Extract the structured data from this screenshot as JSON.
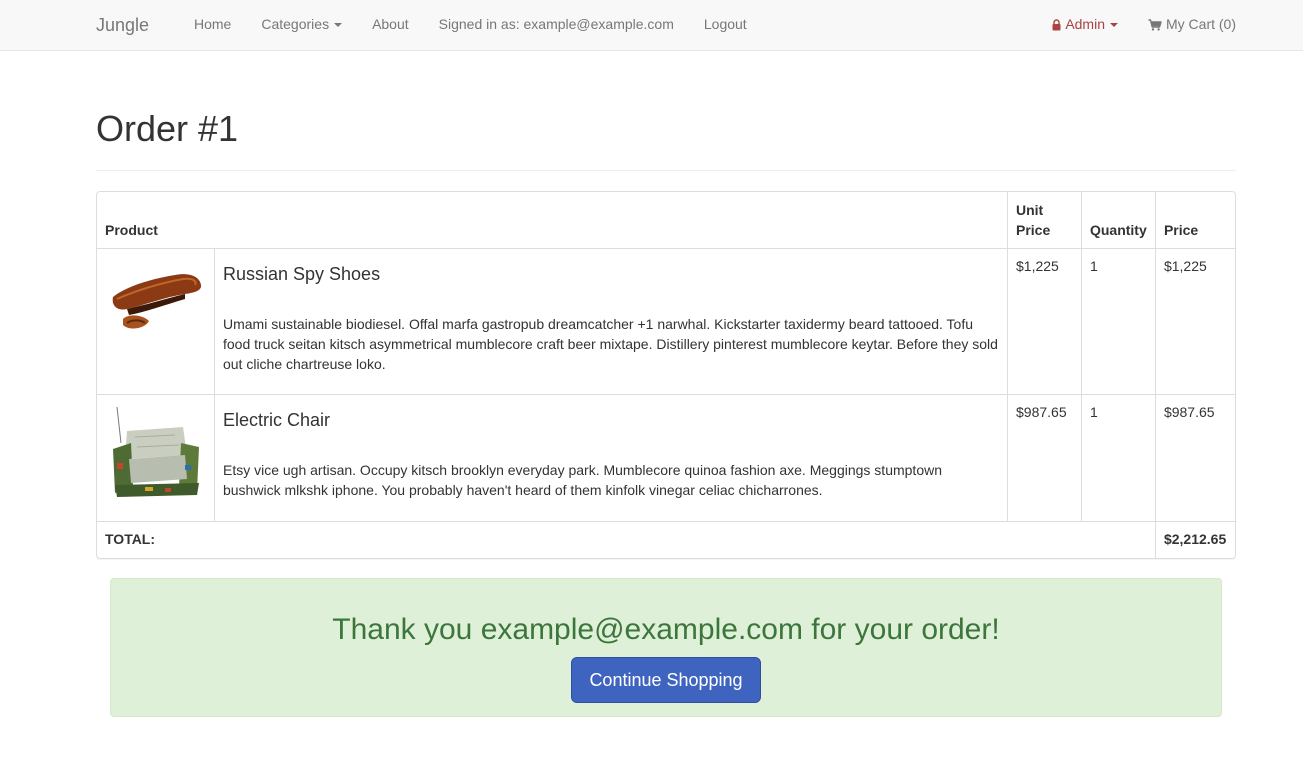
{
  "nav": {
    "brand": "Jungle",
    "home": "Home",
    "categories": "Categories",
    "about": "About",
    "signed_in": "Signed in as: example@example.com",
    "logout": "Logout",
    "admin": "Admin",
    "cart": "My Cart (0)",
    "icons": {
      "admin": "lock-icon",
      "cart": "shopping-cart-icon",
      "dropdown": "caret-down-icon"
    },
    "colors": {
      "admin": "#a94442",
      "link": "#777777"
    }
  },
  "page": {
    "title": "Order #1"
  },
  "table": {
    "headers": {
      "product": "Product",
      "unit_price": "Unit Price",
      "quantity": "Quantity",
      "price": "Price"
    },
    "items": [
      {
        "name": "Russian Spy Shoes",
        "description": "Umami sustainable biodiesel. Offal marfa gastropub dreamcatcher +1 narwhal. Kickstarter taxidermy beard tattooed. Tofu food truck seitan kitsch asymmetrical mumblecore craft beer mixtape. Distillery pinterest mumblecore keytar. Before they sold out cliche chartreuse loko.",
        "unit_price": "$1,225",
        "quantity": "1",
        "price": "$1,225",
        "image": "shoe-image"
      },
      {
        "name": "Electric Chair",
        "description": "Etsy vice ugh artisan. Occupy kitsch brooklyn everyday park. Mumblecore quinoa fashion axe. Meggings stumptown bushwick mlkshk iphone. You probably haven't heard of them kinfolk vinegar celiac chicharrones.",
        "unit_price": "$987.65",
        "quantity": "1",
        "price": "$987.65",
        "image": "chair-image"
      }
    ],
    "total_label": "TOTAL:",
    "total_value": "$2,212.65"
  },
  "alert": {
    "message": "Thank you example@example.com for your order!",
    "button": "Continue Shopping",
    "colors": {
      "background": "#dff0d8",
      "text": "#3c763d",
      "button": "#3e64c0"
    }
  }
}
